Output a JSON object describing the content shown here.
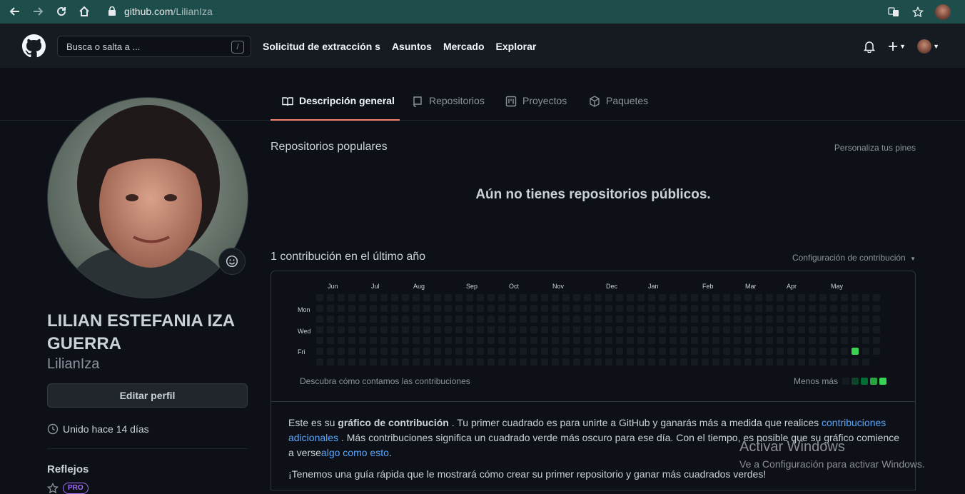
{
  "browser": {
    "url_host": "github.com",
    "url_path": "/LilianIza"
  },
  "header": {
    "search_placeholder": "Busca o salta a ...",
    "search_shortcut": "/",
    "nav": [
      "Solicitud de extracción s",
      "Asuntos",
      "Mercado",
      "Explorar"
    ]
  },
  "tabs": [
    {
      "label": "Descripción general",
      "icon": "book-icon",
      "active": true
    },
    {
      "label": "Repositorios",
      "icon": "repo-icon",
      "active": false
    },
    {
      "label": "Proyectos",
      "icon": "project-icon",
      "active": false
    },
    {
      "label": "Paquetes",
      "icon": "package-icon",
      "active": false
    }
  ],
  "profile": {
    "full_name": "LILIAN ESTEFANIA IZA GUERRA",
    "username": "LilianIza",
    "edit_label": "Editar perfil",
    "joined": "Unido hace 14 días",
    "highlights_title": "Reflejos",
    "highlights_badge": "PRO"
  },
  "popular": {
    "title": "Repositorios populares",
    "customize": "Personaliza tus pines",
    "empty": "Aún no tienes repositorios públicos."
  },
  "contrib": {
    "title": "1 contribución en el último año",
    "settings": "Configuración de contribución",
    "months": [
      "Jun",
      "Jul",
      "Aug",
      "Sep",
      "Oct",
      "Nov",
      "Dec",
      "Jan",
      "Feb",
      "Mar",
      "Apr",
      "May"
    ],
    "days": [
      "Mon",
      "Wed",
      "Fri"
    ],
    "learn": "Descubra cómo contamos las contribuciones",
    "legend_label": "Menos más",
    "weeks": 53,
    "active_cell": {
      "week": 50,
      "day": 5
    },
    "colors": {
      "empty": "#161b22",
      "l1": "#0e4429",
      "l2": "#006d32",
      "l3": "#26a641",
      "l4": "#39d353"
    }
  },
  "info": {
    "p1_a": "Este es su ",
    "p1_b": "gráfico de contribución",
    "p1_c": " . Tu primer cuadrado es para unirte a GitHub y ganarás más a medida que realices ",
    "p1_link1": "contribuciones adicionales",
    "p1_d": " . Más contribuciones significa un cuadrado verde más oscuro para ese día. Con el tiempo, es posible que su gráfico comience a verse",
    "p1_link2": "algo como esto",
    "p1_e": ".",
    "p2": "¡Tenemos una guía rápida que le mostrará cómo crear su primer repositorio y ganar más cuadrados verdes!"
  },
  "watermark": {
    "line1": "Activar Windows",
    "line2": "Ve a Configuración para activar Windows."
  }
}
